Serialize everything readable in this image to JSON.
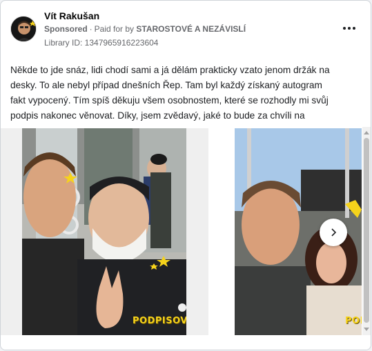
{
  "post": {
    "page_name": "Vít Rakušan",
    "sponsored_label": "Sponsored",
    "paid_for_prefix": "Paid for by",
    "sponsor_name": "STAROSTOVÉ A NEZÁVISLÍ",
    "library_id": "Library ID: 1347965916223604",
    "text": "Někde to jde snáz, lidi chodí sami a já dělám prakticky vzato jenom držák na desky. To ale nebyl případ dnešních Řep. Tam byl každý získaný autogram fakt vypocený. Tím spíš děkuju všem osobnostem, které se rozhodly mi svůj podpis nakonec věnovat. Díky, jsem zvědavý, jaké to bude za chvíli na Kladně!"
  },
  "carousel": {
    "slides": [
      {
        "watermark": "PODPISOVKA"
      },
      {
        "watermark": "POD"
      }
    ]
  },
  "icons": {
    "more": "more-dots-icon",
    "next": "chevron-right-icon",
    "avatar": "avatar-photo"
  }
}
